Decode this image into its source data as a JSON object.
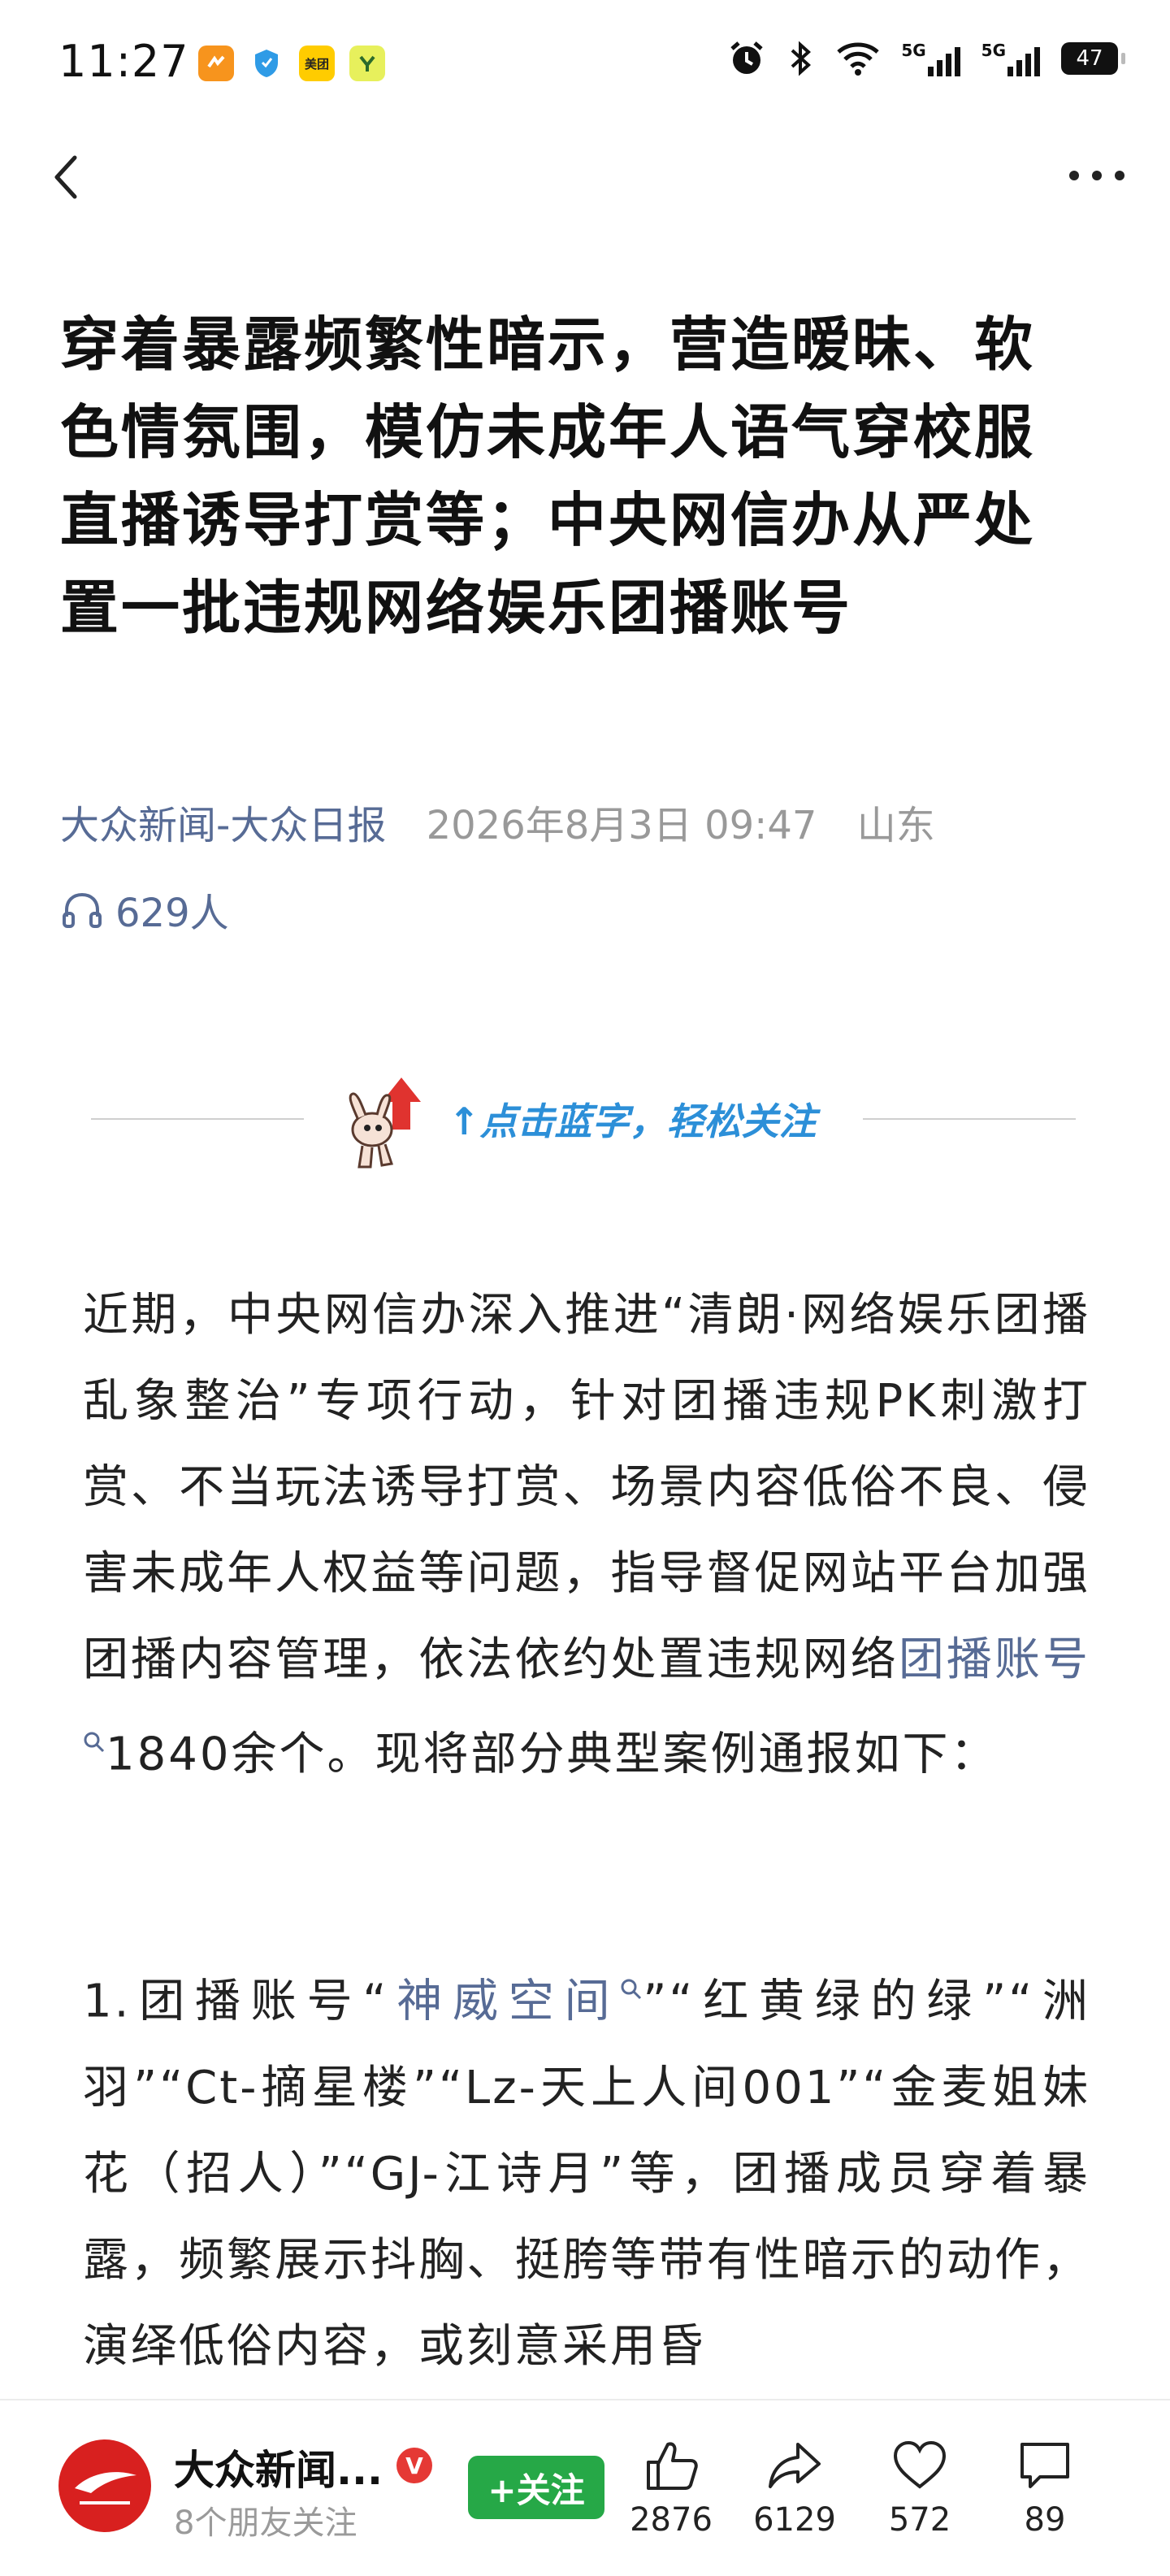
{
  "status_bar": {
    "time": "11:27",
    "apps": [
      {
        "icon": "app-icon-orange",
        "color": "#f7941d",
        "label": ""
      },
      {
        "icon": "shield-icon",
        "color": "#2f9be6",
        "label": ""
      },
      {
        "icon": "meituan-icon",
        "color": "#ffcc00",
        "label": "美团"
      },
      {
        "icon": "app-icon-yellow",
        "color": "#e7f05c",
        "label": ""
      }
    ],
    "signal1": "5G",
    "signal2": "5G",
    "battery": "47"
  },
  "article": {
    "title": "穿着暴露频繁性暗示，营造暧昧、软色情氛围，模仿未成年人语气穿校服直播诱导打赏等；中央网信办从严处置一批违规网络娱乐团播账号",
    "source": "大众新闻-大众日报",
    "date": "2026年8月3日 09:47",
    "region": "山东",
    "listeners": "629人"
  },
  "banner": {
    "follow_hint": "↑点击蓝字，轻松关注"
  },
  "paragraph1": {
    "text_before": "近期，中央网信办深入推进“清朗·网络娱乐团播乱象整治”专项行动，针对团播违规PK刺激打赏、不当玩法诱导打赏、场景内容低俗不良、侵害未成年人权益等问题，指导督促网站平台加强团播内容管理，依法依约处置违规网络",
    "link": "团播账号",
    "text_after": "1840余个。现将部分典型案例通报如下："
  },
  "paragraph2": {
    "text_before": "1.团播账号“",
    "link": "神威空间",
    "text_after": "”“红黄绿的绿”“洲羽”“Ct-摘星楼”“Lz-天上人间001”“金麦姐妹花（招人）”“GJ-江诗月”等，团播成员穿着暴露，频繁展示抖胸、挺胯等带有性暗示的动作，演绎低俗内容，或刻意采用昏"
  },
  "bottom_bar": {
    "account_name": "大众新闻...",
    "verified_mark": "V",
    "friends_following": "8个朋友关注",
    "follow_button": "+关注",
    "likes": "2876",
    "shares": "6129",
    "favorites": "572",
    "comments": "89"
  },
  "colors": {
    "link": "#576b95",
    "follow_green": "#26a847",
    "banner_blue": "#2c8fd8",
    "logo_red": "#d8201f"
  }
}
